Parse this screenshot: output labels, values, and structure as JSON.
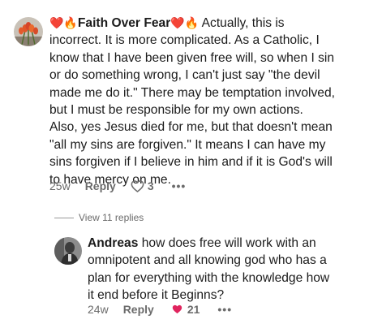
{
  "comment": {
    "author": "Faith Over Fear",
    "author_emoji_left": "❤️🔥",
    "author_emoji_right": "❤️🔥",
    "lines": [
      "Actually, this is",
      "incorrect. It is more complicated. As a Catholic, I",
      "know that I have been given free will, so when I sin",
      "or do something wrong, I can't just say \"the devil",
      "made me do it.\" There may be temptation involved,",
      "but I must be responsible for my own actions.",
      "Also, yes Jesus died for me, but that doesn't mean",
      "\"all my sins are forgiven.\" It means I can have my",
      "sins forgiven if I believe in him and if it is God's will",
      "to have mercy on me."
    ],
    "timestamp": "25w",
    "reply_label": "Reply",
    "like_count": "3",
    "more": "•••"
  },
  "view_replies": "View 11 replies",
  "reply": {
    "author": "Andreas",
    "lines": [
      "how does free will work with an",
      "omnipotent and all knowing god who has a",
      "plan for everything with the knowledge how",
      "it end before it Beginns?"
    ],
    "timestamp": "24w",
    "reply_label": "Reply",
    "like_count": "21",
    "more": "•••"
  },
  "colors": {
    "heart_liked": "#e0245e",
    "meta_text": "#6b6b6b"
  },
  "icons": {
    "comment_avatar": "tulips-avatar",
    "reply_avatar": "person-avatar",
    "like": "heart-outline-icon",
    "liked": "heart-filled-icon"
  }
}
